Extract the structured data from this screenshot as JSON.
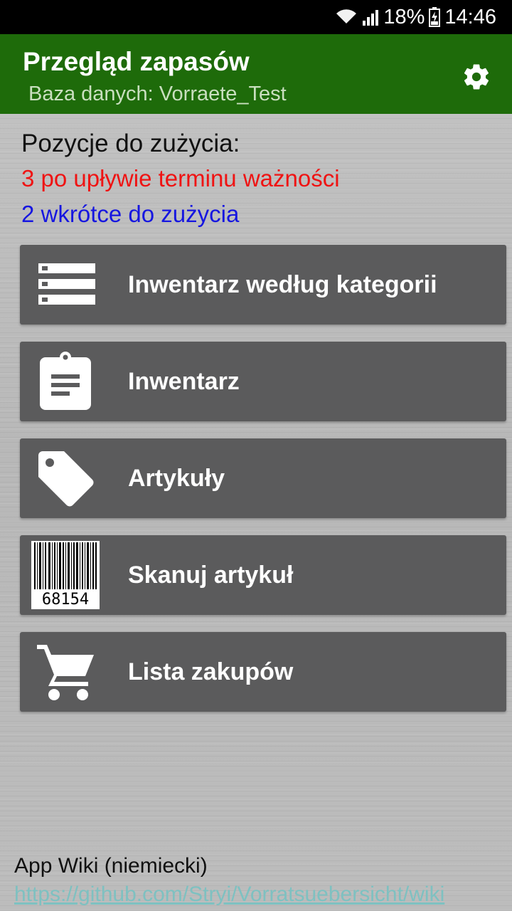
{
  "status_bar": {
    "battery": "18%",
    "time": "14:46",
    "icons": [
      "wifi-icon",
      "signal-icon",
      "battery-charging-icon"
    ]
  },
  "app_bar": {
    "title": "Przegląd zapasów",
    "subtitle": "Baza danych: Vorraete_Test",
    "settings_icon": "gear-icon",
    "color": "#1e6b0a"
  },
  "summary": {
    "heading": "Pozycje do zużycia:",
    "expired": "3 po upływie terminu ważności",
    "soon": "2 wkrótce do zużycia",
    "expired_color": "#ef1313",
    "soon_color": "#1616e0"
  },
  "menu": {
    "items": [
      {
        "label": "Inwentarz według kategorii",
        "icon": "list-icon"
      },
      {
        "label": "Inwentarz",
        "icon": "clipboard-icon"
      },
      {
        "label": "Artykuły",
        "icon": "tag-icon"
      },
      {
        "label": "Skanuj artykuł",
        "icon": "barcode-icon",
        "barcode_number": "68154"
      },
      {
        "label": "Lista zakupów",
        "icon": "shopping-cart-icon"
      }
    ]
  },
  "footer": {
    "wiki_label": "App Wiki (niemiecki)",
    "wiki_url": "https://github.com/Stryi/Vorratsuebersicht/wiki"
  }
}
